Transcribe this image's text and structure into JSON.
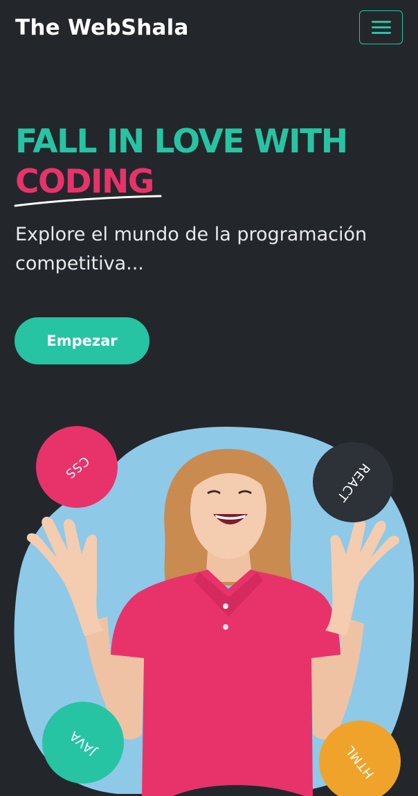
{
  "navbar": {
    "brand": "The WebShala",
    "menu_icon": "hamburger-menu-icon"
  },
  "hero": {
    "headline_line1": "FALL IN LOVE WITH",
    "headline_line2": "CODING",
    "tagline": "Explore el mundo de la programación competitiva...",
    "cta_label": "Empezar"
  },
  "badges": {
    "css": "CSS",
    "react": "REACT",
    "java": "JAVA",
    "html": "HTML"
  },
  "colors": {
    "background": "#23272c",
    "accent_teal": "#27c4a3",
    "accent_pink": "#e8336a",
    "blob_blue": "#8ec9e8",
    "badge_dark": "#2d3138",
    "badge_orange": "#f0a32a"
  }
}
